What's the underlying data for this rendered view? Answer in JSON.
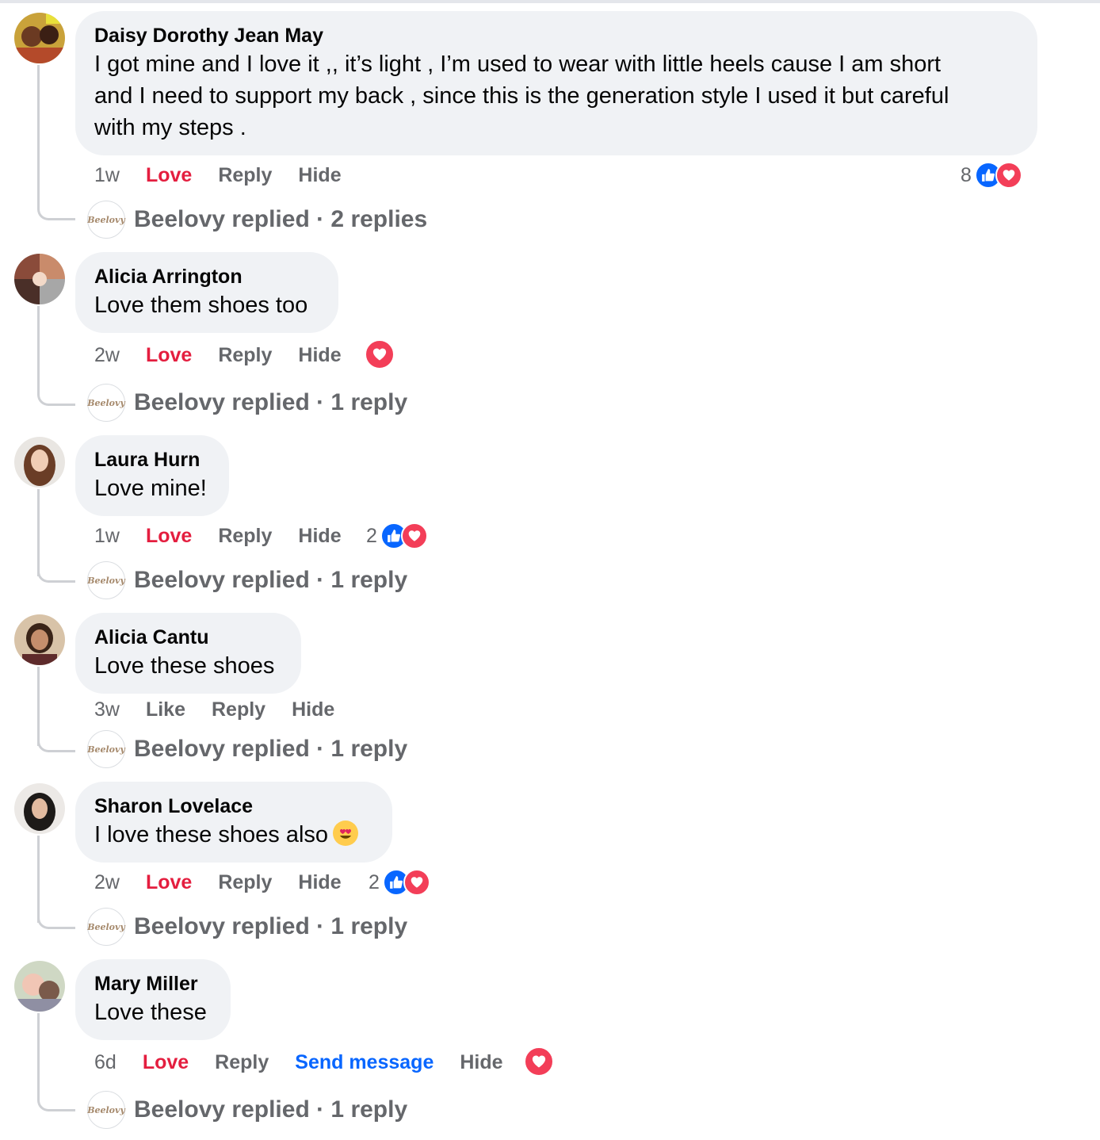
{
  "colors": {
    "bubble_bg": "#f0f2f5",
    "love_red": "#e41e3f",
    "link_blue": "#0866ff",
    "meta_gray": "#65676b",
    "heart_react": "#f33e58"
  },
  "page_logo_text": "Beelovy",
  "comments": [
    {
      "author": "Daisy Dorothy Jean May",
      "lines": [
        "I got mine and I love it ,, it’s light , I’m used to wear with little heels cause I am short",
        "and I need to support my back , since this is the generation style I used it but careful",
        "with my steps ."
      ],
      "time": "1w",
      "react_action": "Love",
      "reply": "Reply",
      "hide": "Hide",
      "reaction_count": "8",
      "reaction_icons": [
        "like-icon",
        "heart-icon"
      ],
      "replied_text": "Beelovy replied · 2 replies"
    },
    {
      "author": "Alicia Arrington",
      "lines": [
        "Love them shoes too"
      ],
      "time": "2w",
      "react_action": "Love",
      "reply": "Reply",
      "hide": "Hide",
      "reaction_icons": [
        "heart-icon"
      ],
      "replied_text": "Beelovy replied · 1 reply"
    },
    {
      "author": "Laura Hurn",
      "lines": [
        "Love mine!"
      ],
      "time": "1w",
      "react_action": "Love",
      "reply": "Reply",
      "hide": "Hide",
      "reaction_count": "2",
      "reaction_icons": [
        "like-icon",
        "heart-icon"
      ],
      "replied_text": "Beelovy replied · 1 reply"
    },
    {
      "author": "Alicia Cantu",
      "lines": [
        "Love these shoes"
      ],
      "time": "3w",
      "react_action": "Like",
      "reply": "Reply",
      "hide": "Hide",
      "replied_text": "Beelovy replied · 1 reply"
    },
    {
      "author": "Sharon Lovelace",
      "lines": [
        "I love these shoes also"
      ],
      "emoji": "heart-eyes-emoji",
      "time": "2w",
      "react_action": "Love",
      "reply": "Reply",
      "hide": "Hide",
      "reaction_count": "2",
      "reaction_icons": [
        "like-icon",
        "heart-icon"
      ],
      "replied_text": "Beelovy replied · 1 reply"
    },
    {
      "author": "Mary Miller",
      "lines": [
        "Love these"
      ],
      "time": "6d",
      "react_action": "Love",
      "reply": "Reply",
      "send_message": "Send message",
      "hide": "Hide",
      "reaction_icons": [
        "heart-icon"
      ],
      "replied_text": "Beelovy replied · 1 reply"
    }
  ]
}
